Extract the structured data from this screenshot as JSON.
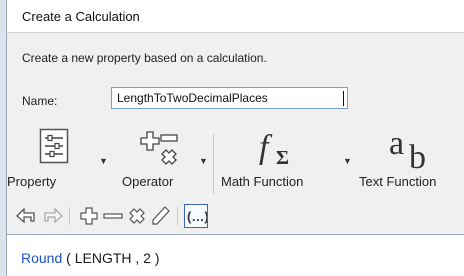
{
  "window": {
    "title": "Create a Calculation"
  },
  "form": {
    "description": "Create a new property based on a calculation.",
    "name_label": "Name:",
    "name_value": "LengthToTwoDecimalPlaces"
  },
  "ribbon": {
    "property_label": "Property",
    "operator_label": "Operator",
    "math_function_label": "Math Function",
    "text_function_label": "Text Function"
  },
  "expression": {
    "function": "Round",
    "rest": " ( LENGTH , 2 )"
  },
  "colors": {
    "accent": "#3a66b5",
    "function_text": "#2050c8"
  }
}
